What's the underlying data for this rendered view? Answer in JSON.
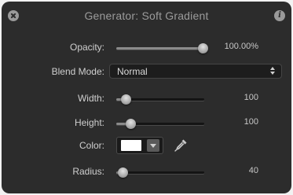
{
  "window": {
    "title": "Generator: Soft Gradient",
    "close_icon": "close-icon",
    "info_icon": "info-icon",
    "info_glyph": "i"
  },
  "params": {
    "opacity": {
      "label": "Opacity:",
      "value": "100.00%",
      "fraction": 1.0
    },
    "blend_mode": {
      "label": "Blend Mode:",
      "value": "Normal"
    },
    "width": {
      "label": "Width:",
      "value": "100",
      "fraction": 0.1
    },
    "height": {
      "label": "Height:",
      "value": "100",
      "fraction": 0.2
    },
    "color": {
      "label": "Color:",
      "swatch_color": "#ffffff",
      "eyedropper_icon": "eyedropper-icon"
    },
    "radius": {
      "label": "Radius:",
      "value": "40",
      "fraction": 0.05
    }
  },
  "colors": {
    "panel_bg": "#2c2c2c",
    "text": "#cfcfcf"
  }
}
